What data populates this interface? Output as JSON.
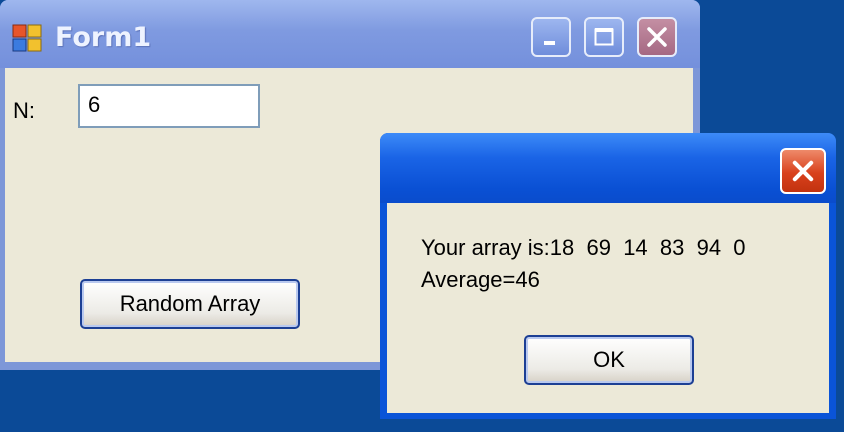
{
  "form1": {
    "title": "Form1",
    "n_label": "N:",
    "n_value": "6",
    "random_button_label": "Random Array",
    "icons": [
      "app-icon",
      "minimize-icon",
      "maximize-icon",
      "close-icon"
    ]
  },
  "message_box": {
    "title": "",
    "line1": "Your array is:18  69  14  83  94  0",
    "line2": "Average=46",
    "ok_label": "OK",
    "icons": [
      "close-icon"
    ]
  },
  "colors": {
    "desktop": "#0b4a97",
    "inactive_titlebar": "#7f9ae0",
    "active_titlebar": "#1a64e6",
    "client_bg": "#ece9d8",
    "close_red": "#d9411c"
  }
}
